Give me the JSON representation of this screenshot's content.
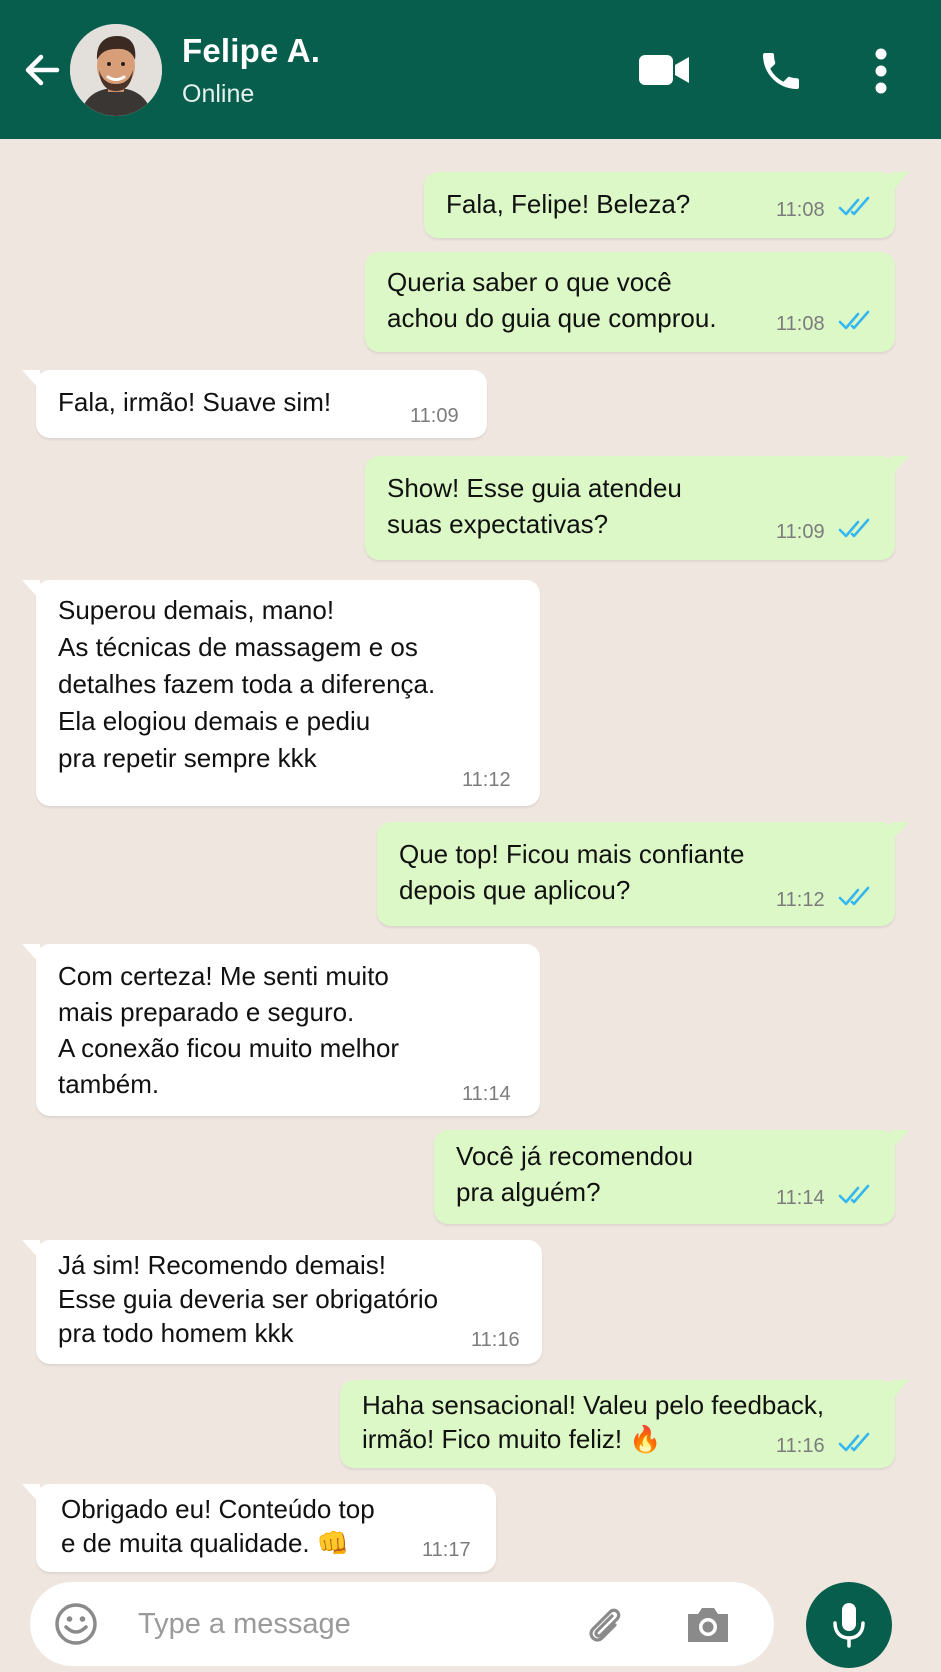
{
  "header": {
    "name": "Felipe A.",
    "status": "Online",
    "colors": {
      "bar": "#075e4d",
      "out_bubble": "#dcf8c6",
      "in_bubble": "#ffffff",
      "background": "#efe7df",
      "tick": "#34b7f1"
    },
    "icons": [
      "back-arrow-icon",
      "avatar",
      "video-call-icon",
      "phone-icon",
      "more-vert-icon"
    ]
  },
  "messages": [
    {
      "dir": "out",
      "text": "Fala, Felipe! Beleza?",
      "time": "11:08",
      "read": true
    },
    {
      "dir": "out",
      "text": "Queria saber o que você\nachou do guia que comprou.",
      "time": "11:08",
      "read": true
    },
    {
      "dir": "in",
      "text": "Fala, irmão! Suave sim!",
      "time": "11:09"
    },
    {
      "dir": "out",
      "text": "Show! Esse guia atendeu\nsuas expectativas?",
      "time": "11:09",
      "read": true
    },
    {
      "dir": "in",
      "text": "Superou demais, mano!\nAs técnicas de massagem e os\ndetalhes fazem toda a diferença.\nEla elogiou demais e pediu\npra repetir sempre kkk",
      "time": "11:12"
    },
    {
      "dir": "out",
      "text": "Que top! Ficou mais confiante\ndepois que aplicou?",
      "time": "11:12",
      "read": true
    },
    {
      "dir": "in",
      "text": "Com certeza! Me senti muito\nmais preparado e seguro.\nA conexão ficou muito melhor\ntambém.",
      "time": "11:14"
    },
    {
      "dir": "out",
      "text": "Você já recomendou\npra alguém?",
      "time": "11:14",
      "read": true
    },
    {
      "dir": "in",
      "text": "Já sim! Recomendo demais!\nEsse guia deveria ser obrigatório\npra todo homem kkk",
      "time": "11:16"
    },
    {
      "dir": "out",
      "text": "Haha sensacional! Valeu pelo feedback,\nirmão! Fico muito feliz! 🔥",
      "time": "11:16",
      "read": true
    },
    {
      "dir": "in",
      "text": "Obrigado eu! Conteúdo top\ne de muita qualidade. 👊",
      "time": "11:17"
    }
  ],
  "input": {
    "placeholder": "Type a message",
    "icons": [
      "emoji-icon",
      "paperclip-icon",
      "camera-icon",
      "mic-icon"
    ]
  }
}
